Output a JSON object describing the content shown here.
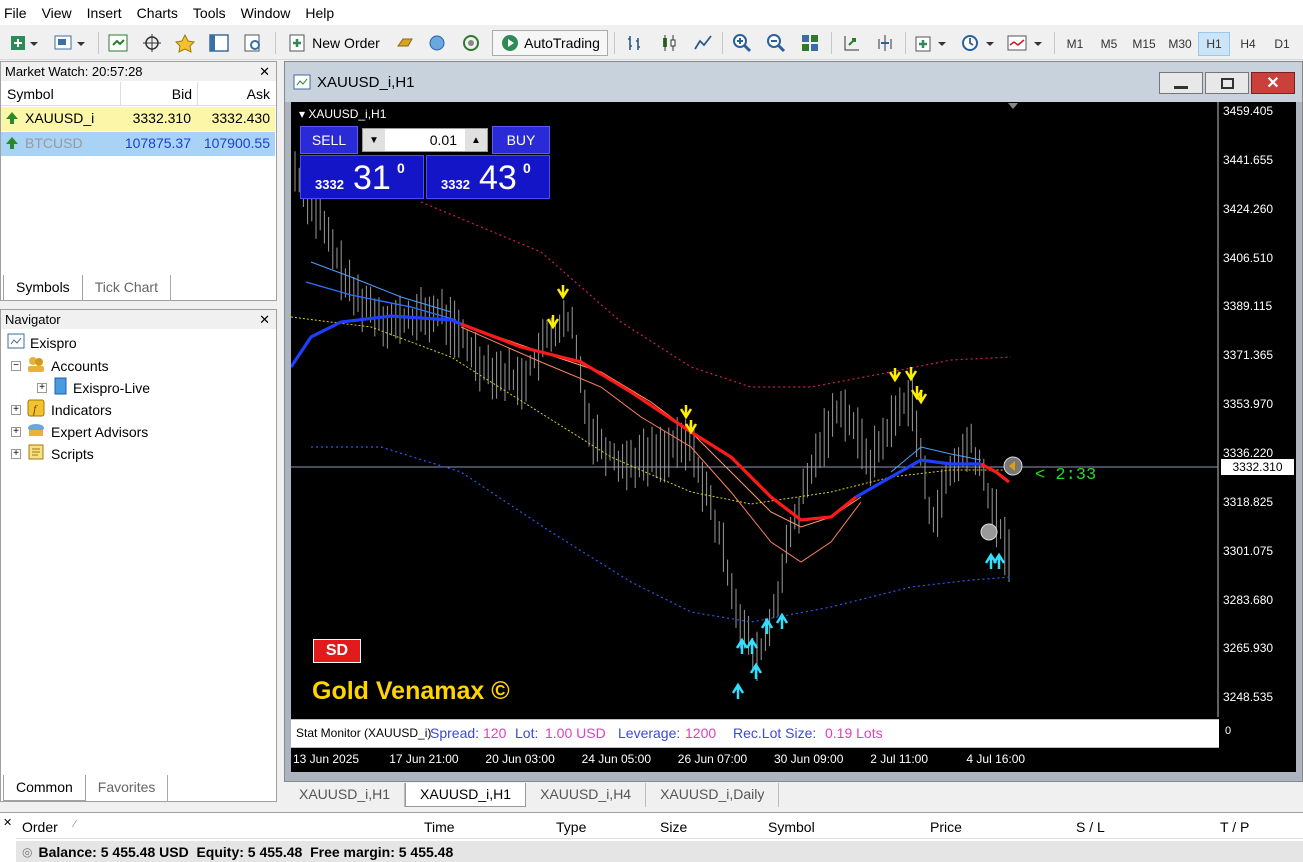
{
  "menu": [
    "File",
    "View",
    "Insert",
    "Charts",
    "Tools",
    "Window",
    "Help"
  ],
  "toolbar": {
    "new_order": "New Order",
    "autotrading": "AutoTrading",
    "timeframes": [
      "M1",
      "M5",
      "M15",
      "M30",
      "H1",
      "H4",
      "D1"
    ],
    "active_tf": "H1"
  },
  "market_watch": {
    "title": "Market Watch: 20:57:28",
    "headers": {
      "symbol": "Symbol",
      "bid": "Bid",
      "ask": "Ask"
    },
    "rows": [
      {
        "symbol": "XAUUSD_i",
        "bid": "3332.310",
        "ask": "3332.430"
      },
      {
        "symbol": "BTCUSD",
        "bid": "107875.37",
        "ask": "107900.55"
      }
    ],
    "tabs": [
      "Symbols",
      "Tick Chart"
    ]
  },
  "navigator": {
    "title": "Navigator",
    "root": "Exispro",
    "items": [
      "Accounts",
      "Exispro-Live",
      "Indicators",
      "Expert Advisors",
      "Scripts"
    ],
    "tabs": [
      "Common",
      "Favorites"
    ]
  },
  "chart": {
    "window_title": "XAUUSD_i,H1",
    "inner_label": "XAUUSD_i,H1",
    "sell": "SELL",
    "buy": "BUY",
    "lot": "0.01",
    "sell_price_small": "3332",
    "sell_price_big": "31",
    "sell_sup": "0",
    "buy_price_small": "3332",
    "buy_price_big": "43",
    "buy_sup": "0",
    "price_axis": [
      "3459.405",
      "3441.655",
      "3424.260",
      "3406.510",
      "3389.115",
      "3371.365",
      "3353.970",
      "3336.220",
      "3318.825",
      "3301.075",
      "3283.680",
      "3265.930",
      "3248.535"
    ],
    "current_price": "3332.310",
    "timer": "< 2:33",
    "time_axis": [
      "13 Jun 2025",
      "17 Jun 21:00",
      "20 Jun 03:00",
      "24 Jun 05:00",
      "26 Jun 07:00",
      "30 Jun 09:00",
      "2 Jul 11:00",
      "4 Jul 16:00"
    ],
    "sd_badge": "SD",
    "brand": "Gold Venamax ©",
    "stat_monitor": {
      "label": "Stat Monitor (XAUUSD_i)",
      "spread_label": "Spread:",
      "spread": "120",
      "lot_label": "Lot:",
      "lot": "1.00 USD",
      "leverage_label": "Leverage:",
      "leverage": "1200",
      "rec_label": "Rec.Lot Size:",
      "rec": "0.19 Lots"
    },
    "indicator_axis": "0"
  },
  "chart_tabs": [
    "XAUUSD_i,H1",
    "XAUUSD_i,H1",
    "XAUUSD_i,H4",
    "XAUUSD_i,Daily"
  ],
  "terminal": {
    "headers": [
      "Order",
      "Time",
      "Type",
      "Size",
      "Symbol",
      "Price",
      "S / L",
      "T / P"
    ],
    "balance_line": "Balance: 5 455.48 USD  Equity: 5 455.48  Free margin: 5 455.48"
  },
  "colors": {
    "chart_bg": "#000000",
    "sell_btn": "#1f1fcf",
    "buy_btn": "#1f1fcf",
    "red_ma": "#ff1a1a",
    "blue_ma": "#1f3fff",
    "brand": "#ffd400"
  }
}
